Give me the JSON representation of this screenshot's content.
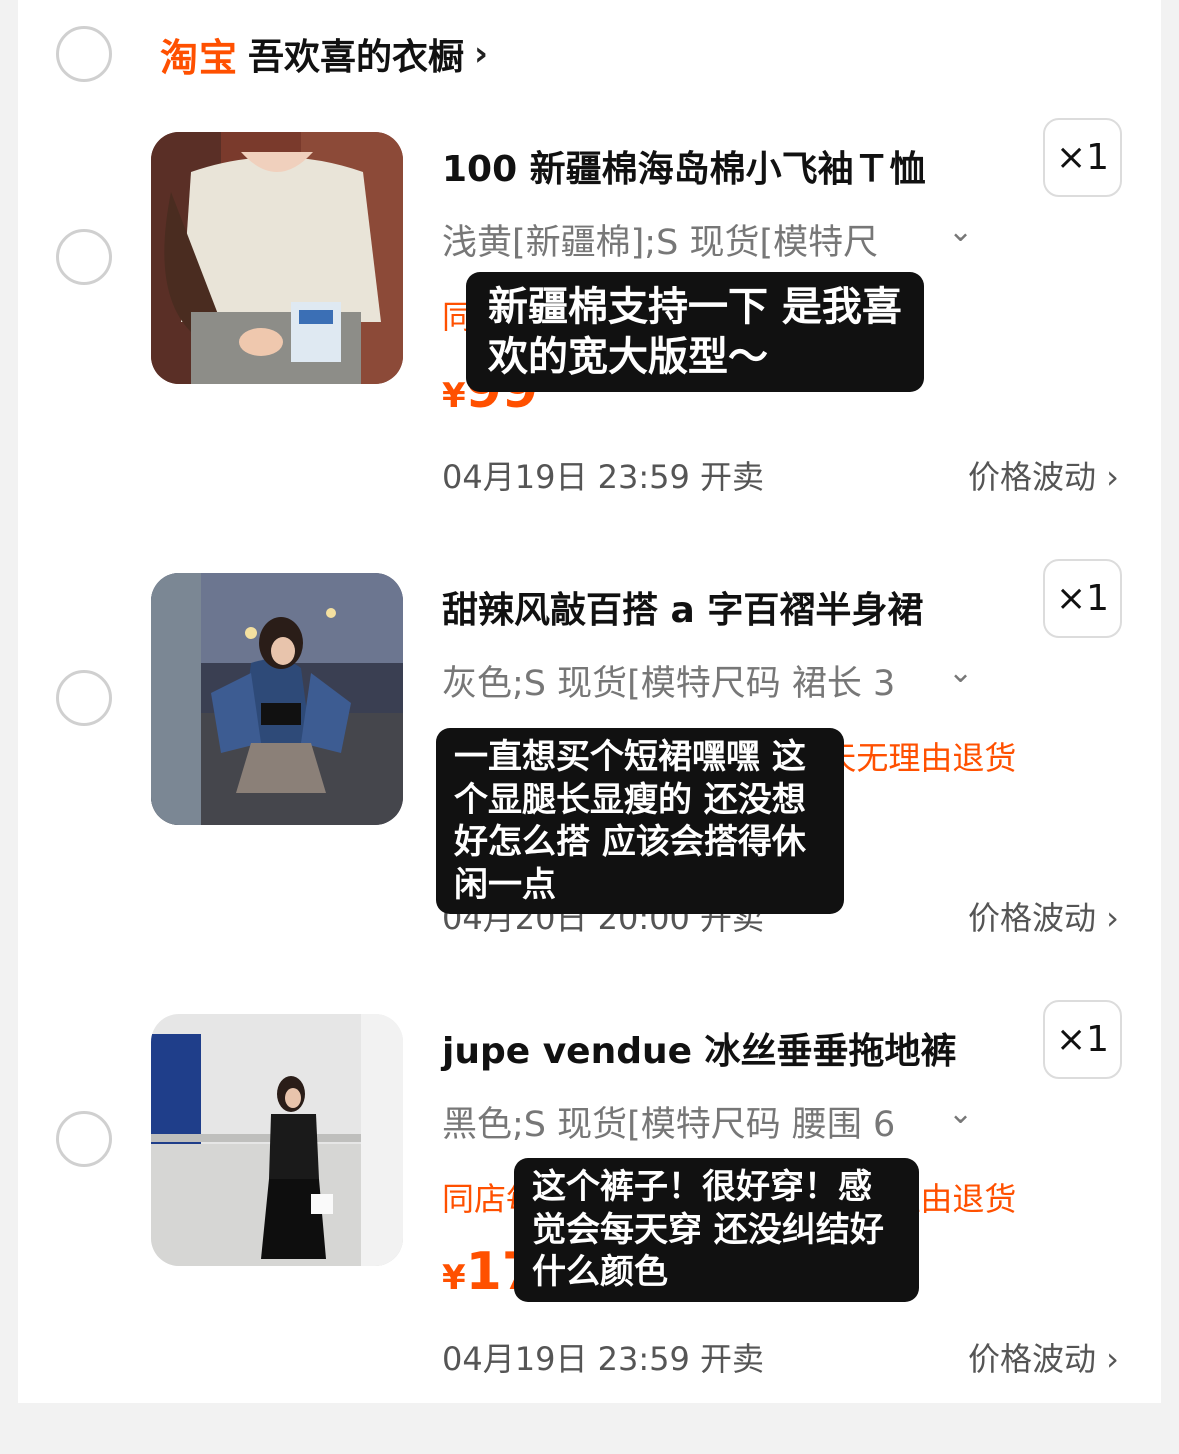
{
  "shop": {
    "brand": "淘宝",
    "name": "吾欢喜的衣橱",
    "chevron": "›"
  },
  "items": [
    {
      "title": "100 新疆棉海岛棉小飞袖Ｔ恤",
      "qty": "×1",
      "sku": "浅黄[新疆棉];S 现货[模特尺",
      "sku_chevron": "⌄",
      "promo": "同店",
      "price_currency": "¥",
      "price_amount": "99",
      "time": "04月19日 23:59 开卖",
      "fluct": "价格波动 ›",
      "note": [
        "新疆棉支持一下 是我喜",
        "欢的宽大版型～"
      ]
    },
    {
      "title": "甜辣风敲百搭 a 字百褶半身裙",
      "qty": "×1",
      "sku": "灰色;S 现货[模特尺码 裙长 3",
      "sku_chevron": "⌄",
      "promo": "同店每 · · · · · · · · · 张 · 7 天无理由退货",
      "price_currency": "¥",
      "price_amount": "",
      "time": "04月20日 20:00 开卖",
      "fluct": "价格波动 ›",
      "note": [
        "一直想买个短裙嘿嘿 这",
        "个显腿长显瘦的 还没想",
        "好怎么搭 应该会搭得休",
        "闲一点"
      ]
    },
    {
      "title": "jupe vendue 冰丝垂垂拖地裤",
      "qty": "×1",
      "sku": "黑色;S 现货[模特尺码 腰围 6",
      "sku_chevron": "⌄",
      "promo": "同店每 · · · · · · · · · 张 · 7 天无理由退货",
      "price_currency": "¥",
      "price_amount": "17",
      "time": "04月19日 23:59 开卖",
      "fluct": "价格波动 ›",
      "note": [
        "这个裤子！很好穿！感",
        "觉会每天穿 还没纠结好",
        "什么颜色"
      ]
    }
  ],
  "colors": {
    "accent": "#ff5000",
    "bubble": "#111111"
  },
  "icons": {
    "select": "radio-circle-icon",
    "chevron": "chevron-right-icon",
    "sku_dropdown": "chevron-down-icon"
  }
}
